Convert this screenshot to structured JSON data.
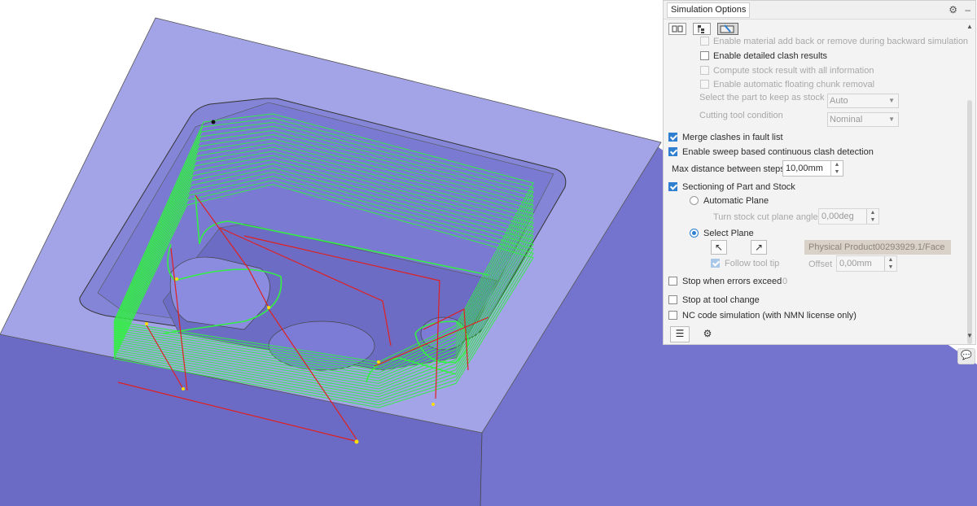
{
  "panel": {
    "title": "Simulation Options",
    "settings_icon": "gear-icon",
    "minimize_icon": "minimize-icon",
    "tabs": [
      {
        "icon": "general-options-icon"
      },
      {
        "icon": "hierarchy-options-icon"
      },
      {
        "icon": "clash-options-icon"
      }
    ],
    "options": {
      "material_add_back": "Enable material add back or remove during backward simulation",
      "detailed_clash": "Enable detailed clash results",
      "compute_stock": "Compute stock result with all information",
      "floating_chunk": "Enable automatic floating chunk removal",
      "select_part_label": "Select the part to keep as stock",
      "select_part_value": "Auto",
      "cutting_tool_label": "Cutting tool condition",
      "cutting_tool_value": "Nominal",
      "merge_clashes": "Merge clashes in fault list",
      "sweep_clash": "Enable sweep based continuous clash detection",
      "max_distance_label": "Max distance between steps",
      "max_distance_value": "10,00mm",
      "sectioning": "Sectioning of Part and Stock",
      "automatic_plane": "Automatic Plane",
      "turn_angle_label": "Turn stock cut plane angle",
      "turn_angle_value": "0,00deg",
      "select_plane": "Select Plane",
      "face_value": "Physical Product00293929.1/Face",
      "follow_tool_tip": "Follow tool tip",
      "offset_label": "Offset",
      "offset_value": "0,00mm",
      "stop_errors": "Stop when errors exceed",
      "stop_errors_value": "0",
      "stop_tool_change": "Stop at tool change",
      "nc_code": "NC code simulation (with NMN license only)"
    },
    "bottom_icons": [
      "list-icon",
      "machine-icon"
    ]
  },
  "colors": {
    "part_top": "#a3a3e8",
    "part_side": "#6f6fc8",
    "toolpath_green": "#33ee44",
    "toolpath_red": "#e02020",
    "accent": "#2f7fd0"
  }
}
